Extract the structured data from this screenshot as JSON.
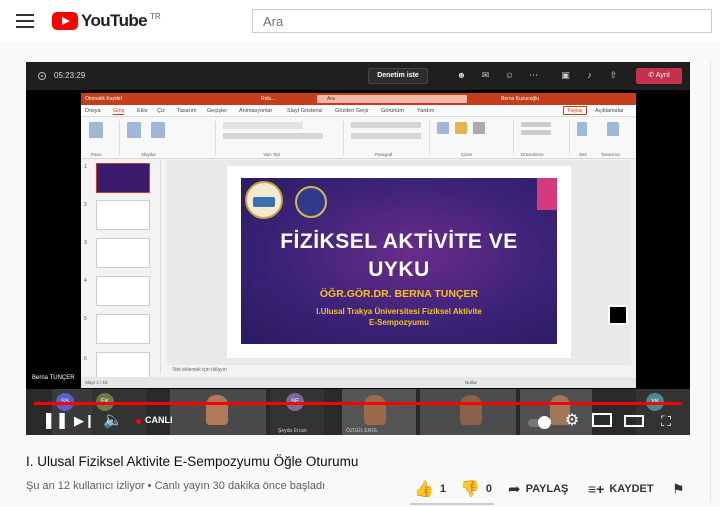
{
  "header": {
    "logo_text": "YouTube",
    "logo_region": "TR",
    "search_placeholder": "Ara"
  },
  "player": {
    "teams": {
      "call_time": "05:23:29",
      "review_button": "Denetim iste",
      "leave_button": "Ayrıl"
    },
    "powerpoint": {
      "search_placeholder": "Ara",
      "title_file": "Rolu...",
      "autosave": "Otomatik Kaydet",
      "user_name": "Berna Kuzucoğlu",
      "tabs": [
        "Dosya",
        "Giriş",
        "Ekle",
        "Çiz",
        "Tasarım",
        "Geçişler",
        "Animasyonlar",
        "Slayt Gösterisi",
        "Gözden Geçir",
        "Görünüm",
        "Yardım"
      ],
      "share": "Paylaş",
      "comments": "Açıklamalar",
      "ribbon_groups": [
        "Pano",
        "Slaytlar",
        "Yazı Tipi",
        "Paragraf",
        "Çizim",
        "Düzenleme",
        "Ses",
        "Tasarımcı"
      ],
      "thumb_numbers": [
        "1",
        "2",
        "3",
        "4",
        "5",
        "6"
      ],
      "notes_placeholder": "Not eklemek için tıklayın",
      "status_left": "Slayt 1 / 18",
      "status_notes": "Notlar",
      "slide": {
        "title_line1": "FİZİKSEL AKTİVİTE VE",
        "title_line2": "UYKU",
        "presenter": "ÖĞR.GÖR.DR. BERNA TUNÇER",
        "subtitle_line1": "I.Ulusal Trakya Üniversitesi Fiziksel Aktivite",
        "subtitle_line2": "E-Sempozyumu"
      }
    },
    "presenter_tag": "Berna TUNÇER",
    "participants": [
      {
        "initials": "SS",
        "name": ""
      },
      {
        "initials": "EK",
        "name": ""
      },
      {
        "initials": "",
        "name": ""
      },
      {
        "initials": "ŞE",
        "name": "Şeyda Ercan"
      },
      {
        "initials": "",
        "name": "ÖZGÜL EROL"
      },
      {
        "initials": "",
        "name": ""
      },
      {
        "initials": "",
        "name": ""
      },
      {
        "initials": "YK",
        "name": ""
      }
    ],
    "live_label": "CANLI"
  },
  "video": {
    "title": "I. Ulusal Fiziksel Aktivite E-Sempozyumu Öğle Oturumu",
    "meta": "Şu an 12 kullanıcı izliyor • Canlı yayın 30 dakika önce başladı",
    "likes": "1",
    "dislikes": "0",
    "share_label": "PAYLAŞ",
    "save_label": "KAYDET"
  },
  "colors": {
    "yt_red": "#ff0000",
    "ppt_orange": "#c43e1c",
    "teams_leave": "#c4314b",
    "slide_purple": "#3b2378",
    "slide_gold": "#f6c21c"
  }
}
